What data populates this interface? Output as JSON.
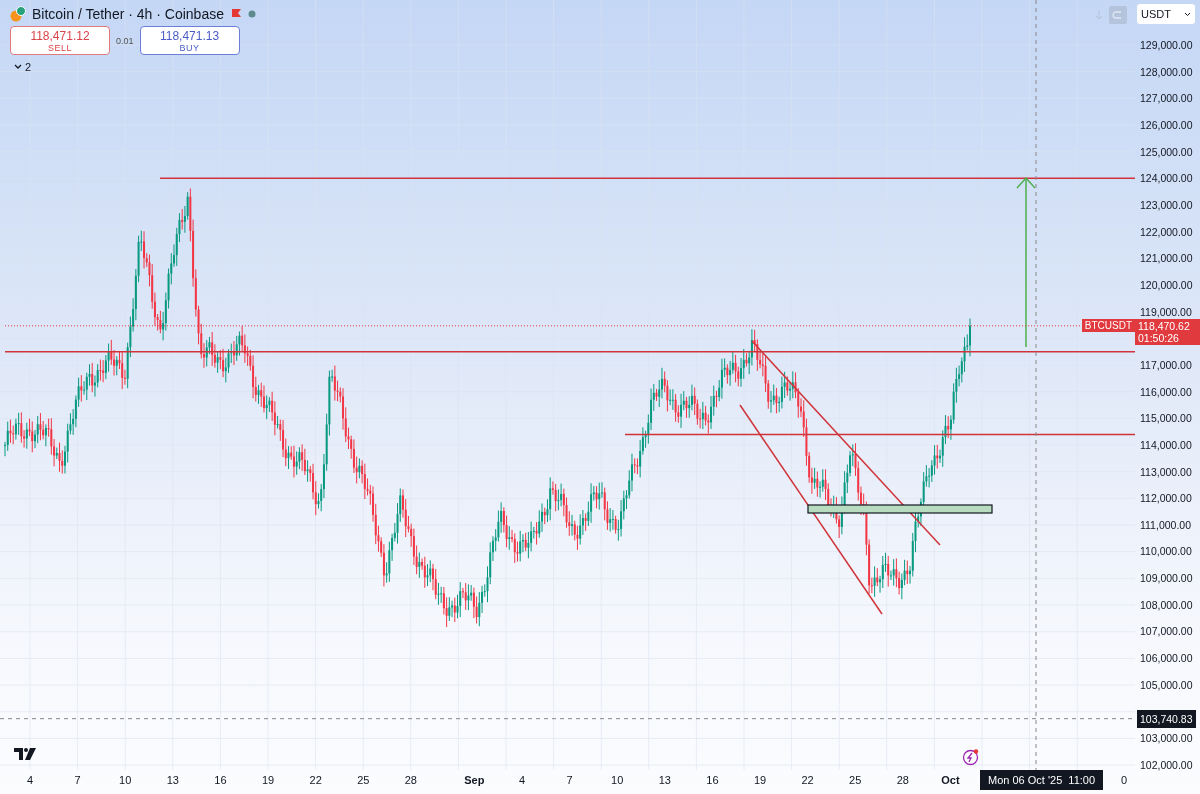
{
  "header": {
    "title": "Bitcoin / Tether · 4h · Coinbase",
    "sell": {
      "price": "118,471.12",
      "label": "SELL"
    },
    "spread": "0.01",
    "buy": {
      "price": "118,471.13",
      "label": "BUY"
    },
    "indicators_toggle": "2"
  },
  "currency_select": {
    "value": "USDT"
  },
  "price_axis": {
    "upper_ticks": [
      "129,000.00",
      "128,000.00",
      "127,000.00",
      "126,000.00",
      "125,000.00",
      "124,000.00",
      "123,000.00",
      "122,000.00",
      "121,000.00",
      "120,000.00",
      "119,000.00"
    ],
    "middle_ticks": [
      "117,000.00",
      "116,000.00",
      "115,000.00",
      "114,000.00",
      "113,000.00",
      "112,000.00",
      "111,000.00",
      "110,000.00",
      "109,000.00",
      "108,000.00",
      "107,000.00",
      "106,000.00",
      "105,000.00"
    ],
    "lower_ticks": [
      "103,000.00",
      "102,000.00"
    ]
  },
  "last_price": {
    "symbol": "BTCUSDT",
    "price": "118,470.62",
    "countdown": "01:50:26"
  },
  "crosshair": {
    "price": "103,740.83",
    "time": "Mon 06 Oct '25  11:00"
  },
  "time_axis": {
    "labels": [
      {
        "text": "4",
        "kind": "day"
      },
      {
        "text": "7",
        "kind": "day"
      },
      {
        "text": "10",
        "kind": "day"
      },
      {
        "text": "13",
        "kind": "day"
      },
      {
        "text": "16",
        "kind": "day"
      },
      {
        "text": "19",
        "kind": "day"
      },
      {
        "text": "22",
        "kind": "day"
      },
      {
        "text": "25",
        "kind": "day"
      },
      {
        "text": "28",
        "kind": "day"
      },
      {
        "text": "Sep",
        "kind": "month"
      },
      {
        "text": "4",
        "kind": "day"
      },
      {
        "text": "7",
        "kind": "day"
      },
      {
        "text": "10",
        "kind": "day"
      },
      {
        "text": "13",
        "kind": "day"
      },
      {
        "text": "16",
        "kind": "day"
      },
      {
        "text": "19",
        "kind": "day"
      },
      {
        "text": "22",
        "kind": "day"
      },
      {
        "text": "25",
        "kind": "day"
      },
      {
        "text": "28",
        "kind": "day"
      },
      {
        "text": "Oct",
        "kind": "month"
      }
    ],
    "trailing_label": "0"
  }
}
